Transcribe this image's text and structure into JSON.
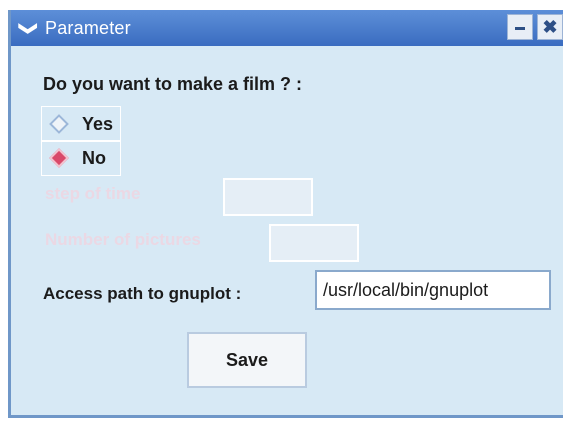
{
  "window": {
    "title": "Parameter",
    "menu_icon": "chevron-down-icon",
    "minimize_icon": "minimize-icon",
    "close_icon": "close-icon",
    "minimize_glyph": "▬",
    "close_glyph": "✖",
    "menu_glyph": "❯"
  },
  "film": {
    "question": "Do you want to make a film ? :",
    "options": [
      {
        "label": "Yes",
        "selected": false
      },
      {
        "label": "No",
        "selected": true
      }
    ]
  },
  "step_of_time": {
    "label": "step of time",
    "value": ""
  },
  "number_of_pictures": {
    "label": "Number of pictures",
    "value": ""
  },
  "gnuplot": {
    "label": "Access path to gnuplot :",
    "value": "/usr/local/bin/gnuplot"
  },
  "save_label": "Save",
  "colors": {
    "titlebar": "#3a6cc0",
    "background": "#d7e9f5",
    "selected_radio": "#d94a6a",
    "disabled_text": "#ebd8e4"
  }
}
